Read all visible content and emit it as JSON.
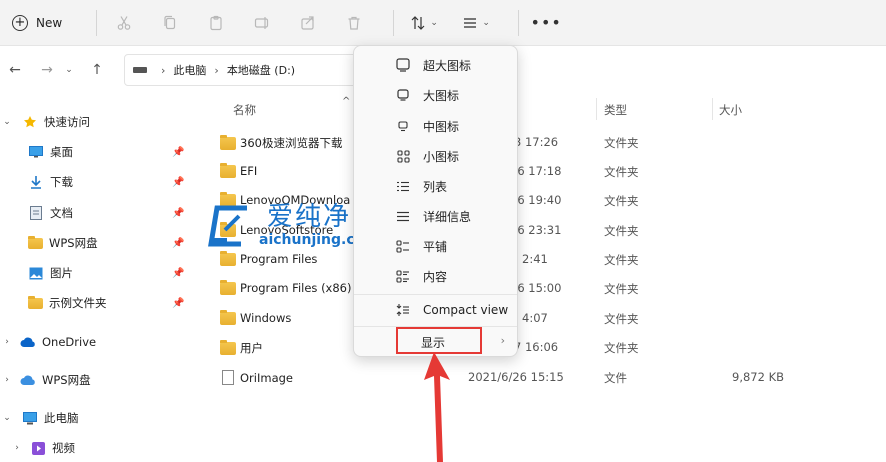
{
  "toolbar": {
    "new_label": "New",
    "new_icon": "plus-circle-icon",
    "buttons": [
      "cut-icon",
      "copy-icon",
      "paste-icon",
      "rename-icon",
      "share-icon",
      "delete-icon"
    ],
    "sort_icon": "sort-icon",
    "view_icon": "view-list-icon",
    "more_icon": "more-icon"
  },
  "nav": {
    "breadcrumb": [
      "此电脑",
      "本地磁盘 (D:)"
    ]
  },
  "sidebar": {
    "items": [
      {
        "label": "快速访问",
        "icon": "star-icon",
        "level": 0,
        "expanded": true
      },
      {
        "label": "桌面",
        "icon": "desktop-icon",
        "level": 1,
        "pinned": true
      },
      {
        "label": "下载",
        "icon": "download-icon",
        "level": 1,
        "pinned": true
      },
      {
        "label": "文档",
        "icon": "document-icon",
        "level": 1,
        "pinned": true
      },
      {
        "label": "WPS网盘",
        "icon": "folder-icon",
        "level": 1,
        "pinned": true
      },
      {
        "label": "图片",
        "icon": "pictures-icon",
        "level": 1,
        "pinned": true
      },
      {
        "label": "示例文件夹",
        "icon": "folder-icon",
        "level": 1,
        "pinned": true
      },
      {
        "label": "OneDrive",
        "icon": "cloud-icon",
        "level": 0,
        "expanded": false
      },
      {
        "label": "WPS网盘",
        "icon": "cloud-icon",
        "level": 0,
        "expanded": false
      },
      {
        "label": "此电脑",
        "icon": "computer-icon",
        "level": 0,
        "expanded": true
      },
      {
        "label": "视频",
        "icon": "video-icon",
        "level": 1,
        "expanded": false
      }
    ]
  },
  "columns": {
    "name": "名称",
    "type": "类型",
    "size": "大小"
  },
  "files": [
    {
      "name": "360极速浏览器下载",
      "date": "3 17:26",
      "type": "文件夹",
      "size": "",
      "kind": "folder"
    },
    {
      "name": "EFI",
      "date": "26 17:18",
      "type": "文件夹",
      "size": "",
      "kind": "folder"
    },
    {
      "name": "LenovoQMDownloa",
      "date": "26 19:40",
      "type": "文件夹",
      "size": "",
      "kind": "folder"
    },
    {
      "name": "LenovoSoftstore",
      "date": "26 23:31",
      "type": "文件夹",
      "size": "",
      "kind": "folder"
    },
    {
      "name": "Program Files",
      "date": "2:41",
      "type": "文件夹",
      "size": "",
      "kind": "folder"
    },
    {
      "name": "Program Files (x86)",
      "date": "26 15:00",
      "type": "文件夹",
      "size": "",
      "kind": "folder"
    },
    {
      "name": "Windows",
      "date": "4:07",
      "type": "文件夹",
      "size": "",
      "kind": "folder"
    },
    {
      "name": "用户",
      "date": "7 16:06",
      "type": "文件夹",
      "size": "",
      "kind": "folder"
    },
    {
      "name": "OriImage",
      "date": "2021/6/26 15:15",
      "type": "文件",
      "size": "9,872 KB",
      "kind": "file"
    }
  ],
  "view_menu": {
    "items": [
      {
        "label": "超大图标",
        "icon": "extra-large-icons-icon"
      },
      {
        "label": "大图标",
        "icon": "large-icons-icon"
      },
      {
        "label": "中图标",
        "icon": "medium-icons-icon"
      },
      {
        "label": "小图标",
        "icon": "small-icons-icon"
      },
      {
        "label": "列表",
        "icon": "list-view-icon"
      },
      {
        "label": "详细信息",
        "icon": "details-view-icon"
      },
      {
        "label": "平铺",
        "icon": "tiles-view-icon"
      },
      {
        "label": "内容",
        "icon": "content-view-icon"
      },
      {
        "label": "Compact view",
        "icon": "compact-view-icon"
      },
      {
        "label": "显示",
        "icon": "",
        "submenu": true
      }
    ]
  },
  "watermark": {
    "name": "爱纯净",
    "url": "aichunjing.com"
  },
  "colors": {
    "accent": "#1a73c9",
    "highlight": "#e53935",
    "folder": "#f5c64e"
  }
}
